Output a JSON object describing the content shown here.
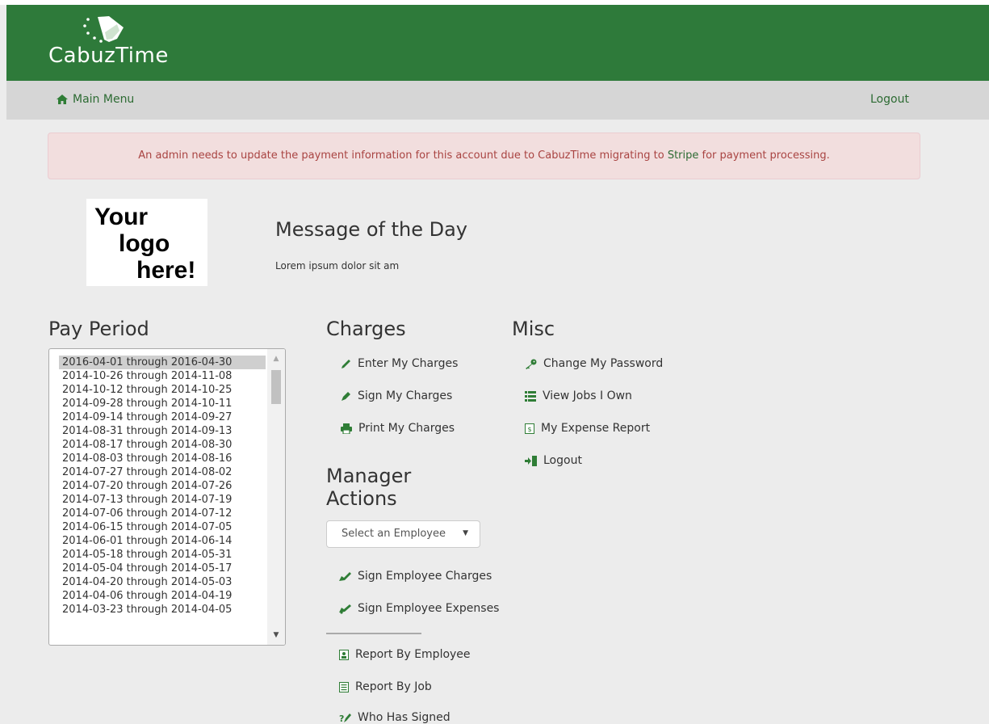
{
  "app": {
    "brand": "CabuzTime"
  },
  "nav": {
    "home_label": "Main Menu",
    "logout_label": "Logout"
  },
  "alert": {
    "text_before": "An admin needs to update the payment information for this account due to CabuzTime migrating to ",
    "link_text": "Stripe",
    "text_after": " for payment processing."
  },
  "company_logo": {
    "lines": [
      "Your",
      "logo",
      "here!"
    ]
  },
  "motd": {
    "title": "Message of the Day",
    "text": "Lorem ipsum dolor sit am"
  },
  "pay_period": {
    "title": "Pay Period",
    "selected_index": 0,
    "items": [
      "2016-04-01 through 2016-04-30",
      "2014-10-26 through 2014-11-08",
      "2014-10-12 through 2014-10-25",
      "2014-09-28 through 2014-10-11",
      "2014-09-14 through 2014-09-27",
      "2014-08-31 through 2014-09-13",
      "2014-08-17 through 2014-08-30",
      "2014-08-03 through 2014-08-16",
      "2014-07-27 through 2014-08-02",
      "2014-07-20 through 2014-07-26",
      "2014-07-13 through 2014-07-19",
      "2014-07-06 through 2014-07-12",
      "2014-06-15 through 2014-07-05",
      "2014-06-01 through 2014-06-14",
      "2014-05-18 through 2014-05-31",
      "2014-05-04 through 2014-05-17",
      "2014-04-20 through 2014-05-03",
      "2014-04-06 through 2014-04-19",
      "2014-03-23 through 2014-04-05"
    ]
  },
  "charges": {
    "title": "Charges",
    "enter_label": "Enter My Charges",
    "sign_label": "Sign My Charges",
    "print_label": "Print My Charges"
  },
  "manager": {
    "title_line1": "Manager",
    "title_line2": "Actions",
    "select_placeholder": "Select an Employee",
    "sign_charges_label": "Sign Employee Charges",
    "sign_expenses_label": "Sign Employee Expenses",
    "report_employee_label": "Report By Employee",
    "report_job_label": "Report By Job",
    "who_signed_label": "Who Has Signed"
  },
  "misc": {
    "title": "Misc",
    "change_password_label": "Change My Password",
    "view_jobs_label": "View Jobs I Own",
    "expense_report_label": "My Expense Report",
    "logout_label": "Logout"
  },
  "colors": {
    "header_green": "#2e7a3a",
    "link_green": "#2d6b33",
    "icon_green": "#2f7d36",
    "alert_bg": "#f2dede",
    "alert_text": "#a94442",
    "nav_bg": "#d6d6d6"
  }
}
